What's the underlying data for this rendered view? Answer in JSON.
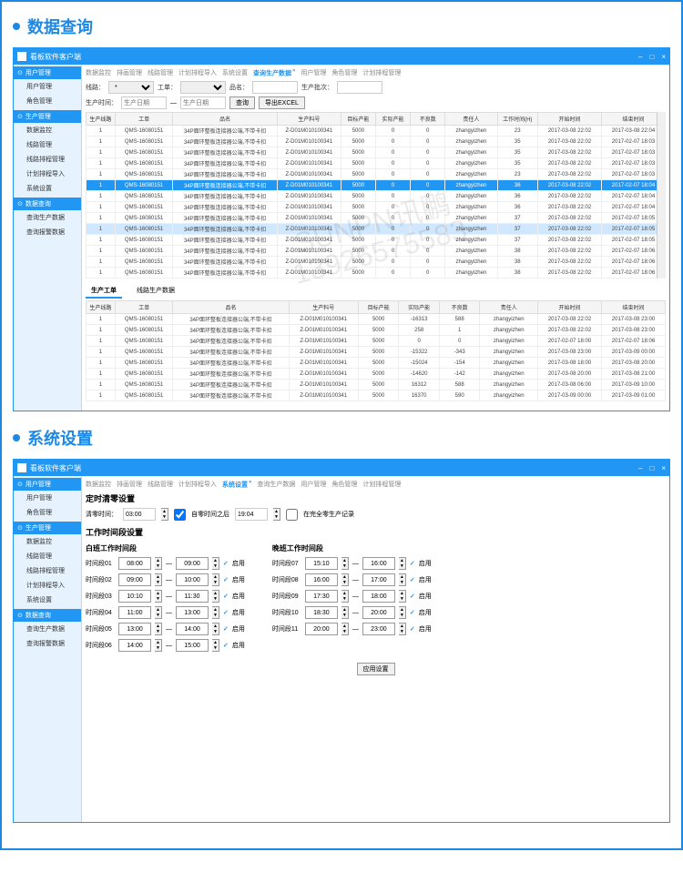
{
  "section1_title": "数据查询",
  "section2_title": "系统设置",
  "window_title": "看板软件客户端",
  "titlebar_controls": {
    "min": "–",
    "max": "□",
    "close": "×"
  },
  "sidebar": {
    "groups": [
      {
        "header": "用户管理",
        "items": [
          "用户管理",
          "角色管理"
        ]
      },
      {
        "header": "生产管理",
        "items": [
          "数据监控",
          "线路管理",
          "线路排程管理",
          "计划排程导入",
          "系统设置"
        ]
      },
      {
        "header": "数据查询",
        "items": [
          "查询生产数据",
          "查询报警数据"
        ]
      }
    ]
  },
  "tabs1": [
    "数据监控",
    "排画管理",
    "线路管理",
    "计划排程导入",
    "系统设置",
    "查询生产数据",
    "用户管理",
    "角色管理",
    "计划排程管理"
  ],
  "tabs1_active": 5,
  "tabs2": [
    "数据监控",
    "排画管理",
    "线路管理",
    "计划排程导入",
    "系统设置",
    "查询生产数据",
    "用户管理",
    "角色管理",
    "计划排程管理"
  ],
  "tabs2_active": 4,
  "filter": {
    "line_label": "线路：",
    "order_label": "工单：",
    "product_label": "品名：",
    "plan_label": "生产批次：",
    "plan_value": "",
    "btn_search": "查询",
    "btn_export": "导出EXCEL",
    "line_value": "*",
    "order_value": "生产日期",
    "date_from": "生产日期",
    "date_to": "生产日期"
  },
  "table1": {
    "headers": [
      "生产线路",
      "工单",
      "品名",
      "生产料号",
      "目标产能",
      "实际产能",
      "不良数",
      "责任人",
      "工作时间(H)",
      "开始时间",
      "结束时间"
    ],
    "rows": [
      [
        "1",
        "QMS-16080151",
        "34P面环整板连接器公端,不带卡扣",
        "Z-D01M010100341",
        "5000",
        "0",
        "0",
        "zhangyizhen",
        "23",
        "2017-03-08 22:02",
        "2017-03-08 22:04"
      ],
      [
        "1",
        "QMS-16080151",
        "34P面环整板连接器公端,不带卡扣",
        "Z-D01M010100341",
        "5000",
        "0",
        "0",
        "zhangyizhen",
        "35",
        "2017-03-08 22:02",
        "2017-02-07 18:03"
      ],
      [
        "1",
        "QMS-16080151",
        "34P面环整板连接器公端,不带卡扣",
        "Z-D01M010100341",
        "5000",
        "0",
        "0",
        "zhangyizhen",
        "35",
        "2017-03-08 22:02",
        "2017-02-07 18:03"
      ],
      [
        "1",
        "QMS-16080151",
        "34P面环整板连接器公端,不带卡扣",
        "Z-D01M010100341",
        "5000",
        "0",
        "0",
        "zhangyizhen",
        "35",
        "2017-03-08 22:02",
        "2017-02-07 18:03"
      ],
      [
        "1",
        "QMS-16080151",
        "34P面环整板连接器公端,不带卡扣",
        "Z-D01M010100341",
        "5000",
        "0",
        "0",
        "zhangyizhen",
        "23",
        "2017-03-08 22:02",
        "2017-02-07 18:03"
      ],
      [
        "1",
        "QMS-16080151",
        "34P面环整板连接器公端,不带卡扣",
        "Z-D01M010100341",
        "5000",
        "0",
        "0",
        "zhangyizhen",
        "36",
        "2017-03-08 22:02",
        "2017-02-07 18:04"
      ],
      [
        "1",
        "QMS-16080151",
        "34P面环整板连接器公端,不带卡扣",
        "Z-D01M010100341",
        "5000",
        "0",
        "0",
        "zhangyizhen",
        "36",
        "2017-03-08 22:02",
        "2017-02-07 18:04"
      ],
      [
        "1",
        "QMS-16080151",
        "34P面环整板连接器公端,不带卡扣",
        "Z-D01M010100341",
        "5000",
        "0",
        "0",
        "zhangyizhen",
        "36",
        "2017-03-08 22:02",
        "2017-02-07 18:04"
      ],
      [
        "1",
        "QMS-16080151",
        "34P面环整板连接器公端,不带卡扣",
        "Z-D01M010100341",
        "5000",
        "0",
        "0",
        "zhangyizhen",
        "37",
        "2017-03-08 22:02",
        "2017-02-07 18:05"
      ],
      [
        "1",
        "QMS-16080151",
        "34P面环整板连接器公端,不带卡扣",
        "Z-D01M010100341",
        "5000",
        "0",
        "0",
        "zhangyizhen",
        "37",
        "2017-03-08 22:02",
        "2017-02-07 18:05"
      ],
      [
        "1",
        "QMS-16080151",
        "34P面环整板连接器公端,不带卡扣",
        "Z-D01M010100341",
        "5000",
        "0",
        "0",
        "zhangyizhen",
        "37",
        "2017-03-08 22:02",
        "2017-02-07 18:05"
      ],
      [
        "1",
        "QMS-16080151",
        "34P面环整板连接器公端,不带卡扣",
        "Z-D01M010100341",
        "5000",
        "0",
        "0",
        "zhangyizhen",
        "38",
        "2017-03-08 22:02",
        "2017-02-07 18:06"
      ],
      [
        "1",
        "QMS-16080151",
        "34P面环整板连接器公端,不带卡扣",
        "Z-D01M010100341",
        "5000",
        "0",
        "0",
        "zhangyizhen",
        "38",
        "2017-03-08 22:02",
        "2017-02-07 18:06"
      ],
      [
        "1",
        "QMS-16080151",
        "34P面环整板连接器公端,不带卡扣",
        "Z-D01M010100341",
        "5000",
        "0",
        "0",
        "zhangyizhen",
        "38",
        "2017-03-08 22:02",
        "2017-02-07 18:06"
      ]
    ],
    "selected_row": 5,
    "highlight_row": 9
  },
  "subtabs": {
    "items": [
      "生产工单",
      "线路生产数据"
    ],
    "active": 0
  },
  "table2": {
    "headers": [
      "生产线路",
      "工单",
      "品名",
      "生产料号",
      "目标产能",
      "实际产能",
      "不良数",
      "责任人",
      "开始时间",
      "结束时间"
    ],
    "rows": [
      [
        "1",
        "QMS-16080151",
        "34P面环整板连接器公端,不带卡扣",
        "Z-D01M010100341",
        "5000",
        "-16313",
        "588",
        "zhangyizhen",
        "2017-03-08 22:02",
        "2017-03-08 23:00"
      ],
      [
        "1",
        "QMS-16080151",
        "34P面环整板连接器公端,不带卡扣",
        "Z-D01M010100341",
        "5000",
        "258",
        "1",
        "zhangyizhen",
        "2017-03-08 22:02",
        "2017-03-08 23:00"
      ],
      [
        "1",
        "QMS-16080151",
        "34P面环整板连接器公端,不带卡扣",
        "Z-D01M010100341",
        "5000",
        "0",
        "0",
        "zhangyizhen",
        "2017-02-07 18:00",
        "2017-02-07 18:06"
      ],
      [
        "1",
        "QMS-16080151",
        "34P面环整板连接器公端,不带卡扣",
        "Z-D01M010100341",
        "5000",
        "-15322",
        "-343",
        "zhangyizhen",
        "2017-03-08 23:00",
        "2017-03-09 00:00"
      ],
      [
        "1",
        "QMS-16080151",
        "34P面环整板连接器公端,不带卡扣",
        "Z-D01M010100341",
        "5000",
        "-15024",
        "-154",
        "zhangyizhen",
        "2017-03-08 18:00",
        "2017-03-08 20:00"
      ],
      [
        "1",
        "QMS-16080151",
        "34P面环整板连接器公端,不带卡扣",
        "Z-D01M010100341",
        "5000",
        "-14620",
        "-142",
        "zhangyizhen",
        "2017-03-08 20:00",
        "2017-03-08 21:00"
      ],
      [
        "1",
        "QMS-16080151",
        "34P面环整板连接器公端,不带卡扣",
        "Z-D01M010100341",
        "5000",
        "16312",
        "588",
        "zhangyizhen",
        "2017-03-08 06:00",
        "2017-03-09 10:00"
      ],
      [
        "1",
        "QMS-16080151",
        "34P面环整板连接器公端,不带卡扣",
        "Z-D01M010100341",
        "5000",
        "16370",
        "590",
        "zhangyizhen",
        "2017-03-09 00:00",
        "2017-03-09 01:00"
      ]
    ]
  },
  "settings": {
    "title": "定时清零设置",
    "clear_label": "清零时间：",
    "clear_value": "03:00",
    "cb1_label": "自零时间之后",
    "cb1_time": "19:04",
    "cb2_label": "在完全零生产记录",
    "section_title": "工作时间段设置",
    "day_title": "白班工作时间段",
    "night_title": "晚班工作时间段",
    "enable": "启用",
    "dash": "—",
    "day_rows": [
      {
        "label": "时间段01",
        "from": "08:00",
        "to": "09:00"
      },
      {
        "label": "时间段02",
        "from": "09:00",
        "to": "10:00"
      },
      {
        "label": "时间段03",
        "from": "10:10",
        "to": "11:30"
      },
      {
        "label": "时间段04",
        "from": "11:00",
        "to": "13:00"
      },
      {
        "label": "时间段05",
        "from": "13:00",
        "to": "14:00"
      },
      {
        "label": "时间段06",
        "from": "14:00",
        "to": "15:00"
      }
    ],
    "night_rows": [
      {
        "label": "时间段07",
        "from": "15:10",
        "to": "16:00"
      },
      {
        "label": "时间段08",
        "from": "16:00",
        "to": "17:00"
      },
      {
        "label": "时间段09",
        "from": "17:30",
        "to": "18:00"
      },
      {
        "label": "时间段10",
        "from": "18:30",
        "to": "20:00"
      },
      {
        "label": "时间段11",
        "from": "20:00",
        "to": "23:00"
      }
    ],
    "save_btn": "应用设置"
  },
  "watermark": {
    "line1": "SUNPN讯鹏",
    "line2": "13926575583"
  }
}
